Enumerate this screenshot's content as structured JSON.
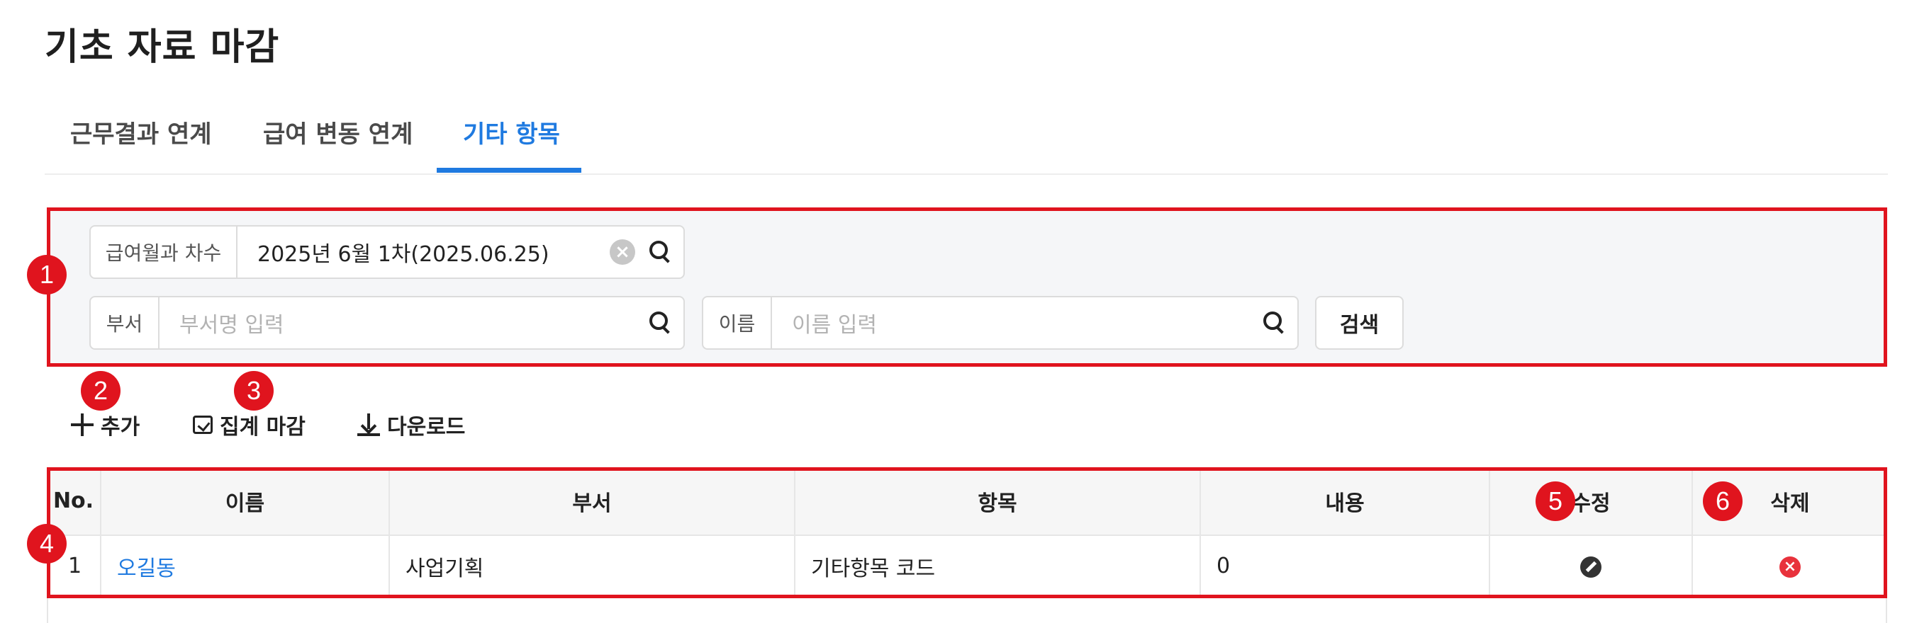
{
  "page": {
    "title": "기초 자료 마감"
  },
  "tabs": [
    {
      "label": "근무결과 연계",
      "active": false
    },
    {
      "label": "급여 변동 연계",
      "active": false
    },
    {
      "label": "기타 항목",
      "active": true
    }
  ],
  "filters": {
    "payroll_round": {
      "label": "급여월과 차수",
      "value": "2025년 6월 1차(2025.06.25)"
    },
    "department": {
      "label": "부서",
      "placeholder": "부서명 입력"
    },
    "name": {
      "label": "이름",
      "placeholder": "이름 입력"
    },
    "search_button": "검색"
  },
  "toolbar": {
    "add_label": "추가",
    "close_label": "집계 마감",
    "download_label": "다운로드"
  },
  "table": {
    "columns": [
      "No.",
      "이름",
      "부서",
      "항목",
      "내용",
      "수정",
      "삭제"
    ],
    "rows": [
      {
        "no": "1",
        "name": "오길동",
        "department": "사업기획",
        "item": "기타항목 코드",
        "content": "0"
      }
    ]
  },
  "annotations": [
    "1",
    "2",
    "3",
    "4",
    "5",
    "6"
  ],
  "colors": {
    "accent": "#1f7ae0",
    "highlight": "#e0141e"
  }
}
